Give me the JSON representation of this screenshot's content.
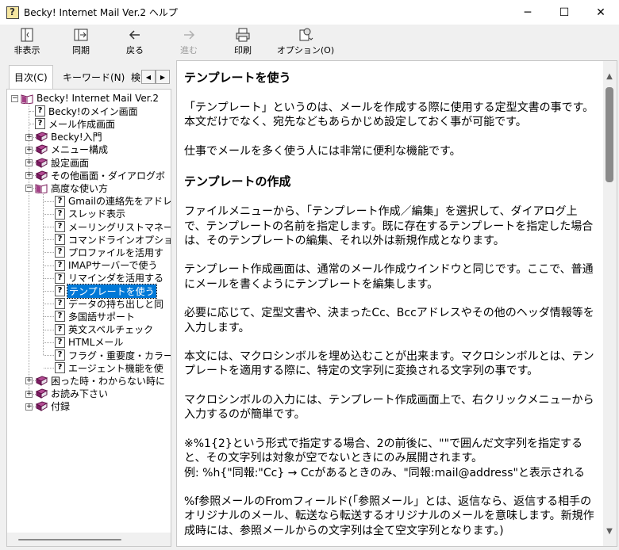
{
  "window": {
    "title": "Becky! Internet Mail Ver.2 ヘルプ",
    "minimize": "─",
    "maximize": "☐",
    "close": "✕"
  },
  "toolbar": {
    "hide": "非表示",
    "sync": "同期",
    "back": "戻る",
    "forward": "進む",
    "print": "印刷",
    "options": "オプション(O)"
  },
  "tabs": {
    "contents": "目次(C)",
    "keyword": "キーワード(N)",
    "search": "検"
  },
  "tree": {
    "root": "Becky! Internet Mail Ver.2",
    "items": [
      "Becky!のメイン画面",
      "メール作成画面",
      "Becky!入門",
      "メニュー構成",
      "設定画面",
      "その他画面・ダイアログボ",
      "高度な使い方",
      "Gmailの連絡先をアドレ",
      "スレッド表示",
      "メーリングリストマネー",
      "コマンドラインオプショ",
      "プロファイルを活用す",
      "IMAPサーバーで使う",
      "リマインダを活用する",
      "テンプレートを使う",
      "データの持ち出しと同",
      "多国語サポート",
      "英文スペルチェック",
      "HTMLメール",
      "フラグ・重要度・カラー",
      "エージェント機能を使",
      "困った時・わからない時に",
      "お読み下さい",
      "付録"
    ]
  },
  "content": {
    "h1": "テンプレートを使う",
    "p1": "「テンプレート」というのは、メールを作成する際に使用する定型文書の事です。本文だけでなく、宛先などもあらかじめ設定しておく事が可能です。",
    "p2": "仕事でメールを多く使う人には非常に便利な機能です。",
    "h2": "テンプレートの作成",
    "p3": "ファイルメニューから、「テンプレート作成／編集」を選択して、ダイアログ上で、テンプレートの名前を指定します。既に存在するテンプレートを指定した場合は、そのテンプレートの編集、それ以外は新規作成となります。",
    "p4": "テンプレート作成画面は、通常のメール作成ウインドウと同じです。ここで、普通にメールを書くようにテンプレートを編集します。",
    "p5": "必要に応じて、定型文書や、決まったCc、Bccアドレスやその他のヘッダ情報等を入力します。",
    "p6": "本文には、マクロシンボルを埋め込むことが出来ます。マクロシンボルとは、テンプレートを適用する際に、特定の文字列に変換される文字列の事です。",
    "p7": "マクロシンボルの入力には、テンプレート作成画面上で、右クリックメニューから入力するのが簡単です。",
    "p8": "※%1{2}という形式で指定する場合、2の前後に、\"\"で囲んだ文字列を指定すると、その文字列は対象が空でないときにのみ展開されます。",
    "p8b": "例: %h{\"同報:\"Cc} → Ccがあるときのみ、\"同報:mail@address\"と表示される",
    "p9": "%f参照メールのFromフィールド(「参照メール」とは、返信なら、返信する相手のオリジナルのメール、転送なら転送するオリジナルのメールを意味します。新規作成時には、参照メールからの文字列は全て空文字列となります。)"
  }
}
